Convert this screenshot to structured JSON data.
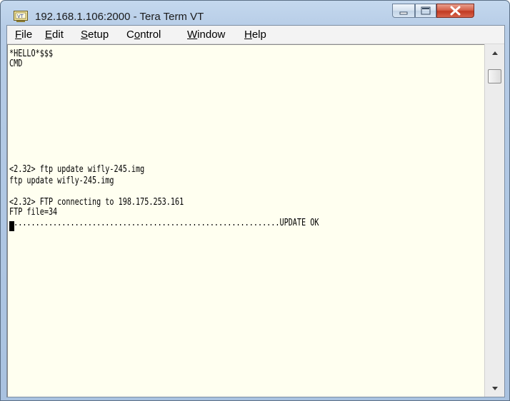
{
  "window": {
    "title": "192.168.1.106:2000 - Tera Term VT",
    "icon": "tera-term-vt-icon"
  },
  "controls": {
    "minimize_icon": "minimize-icon",
    "maximize_icon": "maximize-icon",
    "close_icon": "close-icon"
  },
  "menu": {
    "items": [
      {
        "label": "File",
        "access_key": "F"
      },
      {
        "label": "Edit",
        "access_key": "E"
      },
      {
        "label": "Setup",
        "access_key": "S"
      },
      {
        "label": "Control",
        "access_key": "o"
      },
      {
        "label": "Window",
        "access_key": "W"
      },
      {
        "label": "Help",
        "access_key": "H"
      }
    ]
  },
  "terminal": {
    "lines": [
      "*HELLO*$$$",
      "CMD",
      "",
      "",
      "",
      "<2.32> ftp update wifly-245.img",
      "ftp update wifly-245.img",
      "",
      "<2.32> FTP connecting to 198.175.253.161",
      "FTP file=34",
      "..............................................................UPDATE OK"
    ],
    "background_color": "#fffff0",
    "text_color": "#000000"
  },
  "scrollbar": {
    "up_icon": "scroll-up-arrow-icon",
    "down_icon": "scroll-down-arrow-icon"
  }
}
